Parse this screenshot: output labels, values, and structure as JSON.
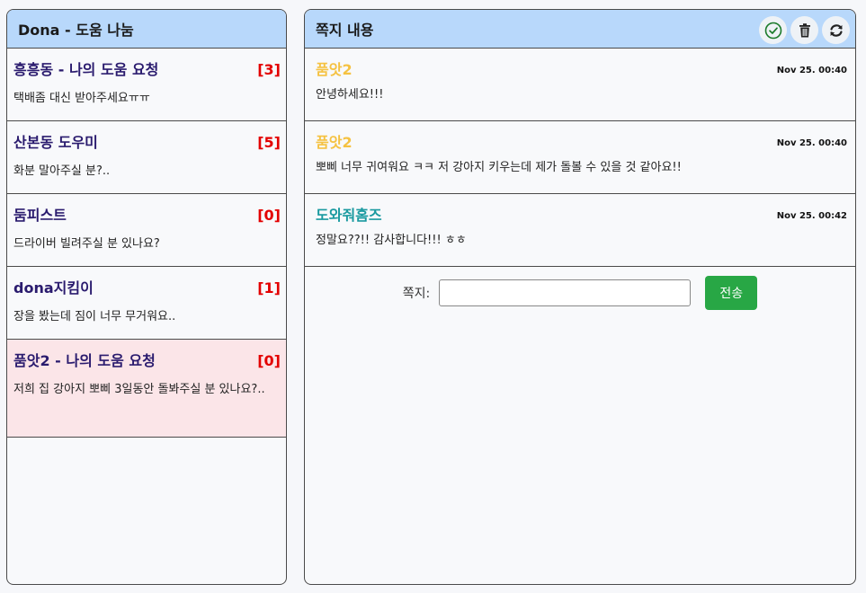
{
  "left": {
    "title": "Dona - 도움 나눔",
    "rooms": [
      {
        "title": "흥흥동 - 나의 도움 요청",
        "count": "[3]",
        "preview": "택배좀 대신 받아주세요ㅠㅠ"
      },
      {
        "title": "산본동 도우미",
        "count": "[5]",
        "preview": "화분 말아주실 분?.."
      },
      {
        "title": "둠피스트",
        "count": "[0]",
        "preview": "드라이버 빌려주실 분 있나요?"
      },
      {
        "title": "dona지킴이",
        "count": "[1]",
        "preview": "장을 봤는데 짐이 너무 무거워요.."
      },
      {
        "title": "품앗2 - 나의 도움 요청",
        "count": "[0]",
        "preview": "저희 집 강아지 뽀삐 3일동안 돌봐주실 분 있나요?.."
      }
    ]
  },
  "right": {
    "title": "쪽지 내용",
    "icons": {
      "confirm": "check-circle-icon",
      "delete": "trash-icon",
      "refresh": "refresh-icon"
    },
    "messages": [
      {
        "sender": "품앗2",
        "time": "Nov 25. 00:40",
        "body": "안녕하세요!!!",
        "color": "#f5c242"
      },
      {
        "sender": "품앗2",
        "time": "Nov 25. 00:40",
        "body": "뽀삐 너무 귀여워요 ㅋㅋ 저 강아지 키우는데 제가 돌볼 수 있을 것 같아요!!",
        "color": "#f5c242"
      },
      {
        "sender": "도와줘홈즈",
        "time": "Nov 25. 00:42",
        "body": "정말요??!! 감사합니다!!! ㅎㅎ",
        "color": "#1a9aa0"
      }
    ],
    "compose": {
      "label": "쪽지:",
      "value": "",
      "send_label": "전송"
    }
  },
  "colors": {
    "header_bg": "#b8d8fb",
    "count": "#e30000",
    "room_title": "#2a1b6e",
    "active_room": "#fbe5e8",
    "send": "#28a745"
  }
}
